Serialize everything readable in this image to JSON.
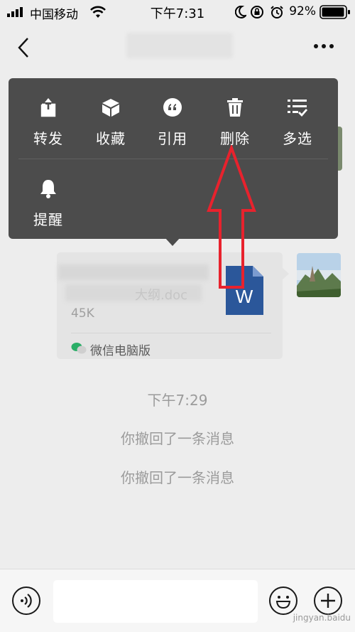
{
  "status_bar": {
    "carrier": "中国移动",
    "time": "下午7:31",
    "battery": "92%"
  },
  "menu": {
    "items": [
      {
        "label": "转发",
        "icon": "share-icon"
      },
      {
        "label": "收藏",
        "icon": "box-icon"
      },
      {
        "label": "引用",
        "icon": "quote-icon"
      },
      {
        "label": "删除",
        "icon": "trash-icon"
      },
      {
        "label": "多选",
        "icon": "multi-select-icon"
      },
      {
        "label": "提醒",
        "icon": "bell-icon"
      }
    ]
  },
  "file_card": {
    "filename": "大纲.doc",
    "size": "45K",
    "source": "微信电脑版",
    "file_type_letter": "W"
  },
  "chat": {
    "timestamp": "下午7:29",
    "recall_1": "你撤回了一条消息",
    "recall_2": "你撤回了一条消息"
  },
  "watermark": "jingyan.baidu",
  "colors": {
    "menu_bg": "#4c4c4c",
    "page_bg": "#ededed",
    "annotation_arrow": "#e8222d",
    "word_blue": "#2b579a"
  }
}
